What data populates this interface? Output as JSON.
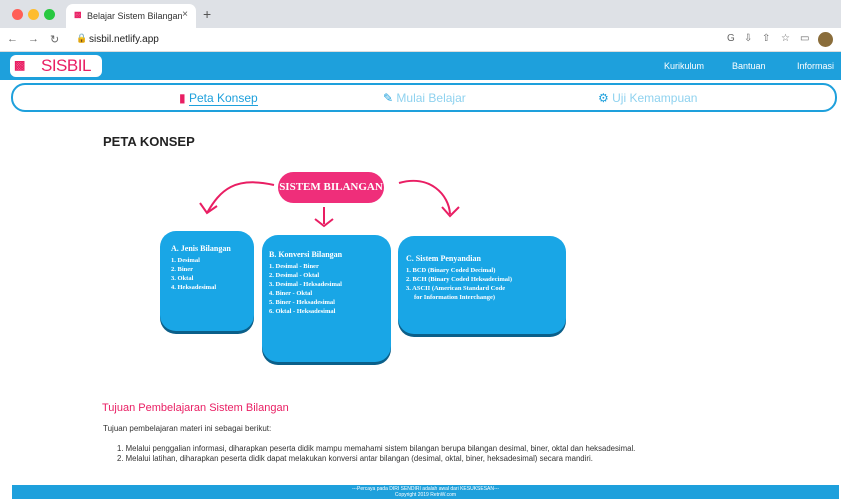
{
  "browser": {
    "tab_title": "Belajar Sistem Bilangan",
    "url": "sisbil.netlify.app"
  },
  "header": {
    "logo_text": "SISBIL",
    "nav": [
      "Kurikulum",
      "Bantuan",
      "Informasi"
    ]
  },
  "menu": {
    "items": [
      "Peta Konsep",
      "Mulai Belajar",
      "Uji Kemampuan"
    ]
  },
  "page": {
    "title": "PETA KONSEP",
    "center": "SISTEM BILANGAN",
    "boxes": [
      {
        "title": "A. Jenis Bilangan",
        "items": [
          "1. Desimal",
          "2. Biner",
          "3. Oktal",
          "4. Heksadesimal"
        ]
      },
      {
        "title": "B. Konversi Bilangan",
        "items": [
          "1. Desimal - Biner",
          "2. Desimal - Oktal",
          "3. Desimal - Heksadesimal",
          "4. Biner - Oktal",
          "5. Biner - Heksadesimal",
          "6. Oktal - Heksadesimal"
        ]
      },
      {
        "title": "C. Sistem Penyandian",
        "items": [
          "1. BCD (Binary Coded Decimal)",
          "2. BCH (Binary Coded Heksadecimal)",
          "3. ASCII (American Standard Code",
          "for Information Interchange)"
        ]
      }
    ],
    "goal_title": "Tujuan Pembelajaran Sistem Bilangan",
    "intro": "Tujuan pembelajaran materi ini sebagai berikut:",
    "goals": [
      "1. Melalui penggalian informasi, diharapkan peserta didik mampu memahami sistem bilangan berupa bilangan desimal, biner, oktal dan heksadesimal.",
      "2. Melalui latihan, diharapkan peserta didik dapat melakukan konversi antar bilangan (desimal, oktal, biner, heksadesimal) secara mandiri."
    ],
    "footer": [
      "---Percaya pada DIRI SENDIRI adalah awal dari KESUKSESAN---",
      "Copyright 2019 RetnW.com"
    ]
  },
  "colors": {
    "brand": "#1ea0dc",
    "accent": "#e91e63"
  }
}
